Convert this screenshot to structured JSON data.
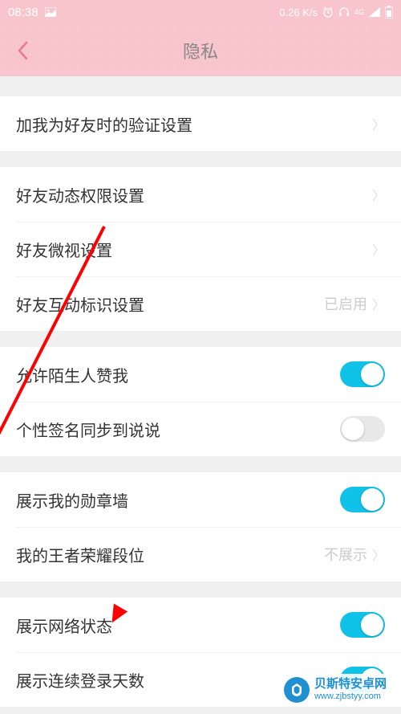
{
  "status": {
    "time": "08:38",
    "speed": "0.26 K/s"
  },
  "header": {
    "title": "隐私"
  },
  "groups": [
    {
      "rows": [
        {
          "label": "加我为好友时的验证设置",
          "type": "nav"
        }
      ]
    },
    {
      "rows": [
        {
          "label": "好友动态权限设置",
          "type": "nav"
        },
        {
          "label": "好友微视设置",
          "type": "nav"
        },
        {
          "label": "好友互动标识设置",
          "type": "nav",
          "value": "已启用"
        }
      ]
    },
    {
      "rows": [
        {
          "label": "允许陌生人赞我",
          "type": "toggle",
          "on": true
        },
        {
          "label": "个性签名同步到说说",
          "type": "toggle",
          "on": false
        }
      ]
    },
    {
      "rows": [
        {
          "label": "展示我的勋章墙",
          "type": "toggle",
          "on": true
        },
        {
          "label": "我的王者荣耀段位",
          "type": "nav",
          "value": "不展示"
        }
      ]
    },
    {
      "rows": [
        {
          "label": "展示网络状态",
          "type": "toggle",
          "on": true
        },
        {
          "label": "展示连续登录天数",
          "type": "toggle",
          "on": true
        }
      ]
    }
  ],
  "watermark": {
    "title": "贝斯特安卓网",
    "url": "www.zjbstyy.com"
  }
}
